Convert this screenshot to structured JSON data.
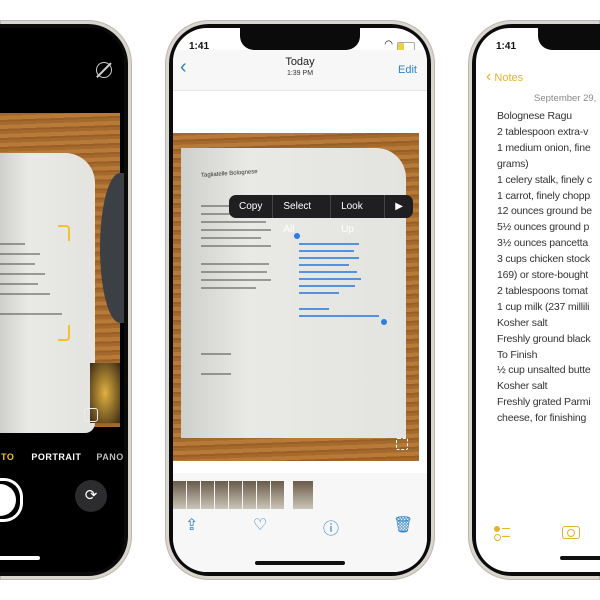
{
  "camera": {
    "modes": [
      "TO",
      "PORTRAIT",
      "PANO"
    ],
    "active_mode_color": "#f2c12e",
    "icons": [
      "live-photo-off-icon",
      "shutter-button",
      "flip-camera-icon",
      "live-text-icon"
    ]
  },
  "photos": {
    "status_time": "1:41",
    "header": {
      "title": "Today",
      "subtitle": "1:39 PM",
      "edit_label": "Edit",
      "back_icon": "chevron-left-icon"
    },
    "context_menu": {
      "items": [
        "Copy",
        "Select All",
        "Look Up"
      ],
      "more_icon": "play-arrow-icon"
    },
    "book_title": "Tagliatelle Bolognese",
    "toolbar": [
      "share-icon",
      "heart-icon",
      "info-icon",
      "trash-icon"
    ],
    "accent": "#2f83c9"
  },
  "notes": {
    "status_time": "1:41",
    "back_label": "Notes",
    "date": "September 29,",
    "lines": [
      "Bolognese Ragu",
      "2 tablespoon extra-v",
      "1 medium onion, fine",
      "grams)",
      "1 celery stalk, finely c",
      "1 carrot, finely chopp",
      "12 ounces ground be",
      "5½ ounces ground p",
      "3½ ounces pancetta",
      "3 cups chicken stock",
      "169) or store-bought",
      "2 tablespoons tomat",
      "1 cup milk (237 millili",
      "Kosher salt",
      "Freshly ground black",
      "To Finish",
      "½ cup unsalted butte",
      "Kosher salt",
      "Freshly grated Parmi",
      "cheese, for finishing"
    ],
    "accent": "#e2b52b"
  }
}
